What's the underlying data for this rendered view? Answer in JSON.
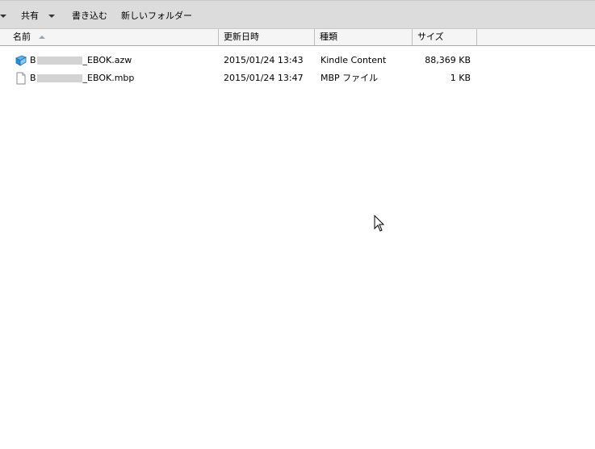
{
  "toolbar": {
    "share_label": "共有",
    "burn_label": "書き込む",
    "new_folder_label": "新しいフォルダー"
  },
  "columns": {
    "name": "名前",
    "date_modified": "更新日時",
    "type": "種類",
    "size": "サイズ"
  },
  "files": [
    {
      "name_prefix": "B",
      "name_suffix": "_EBOK.azw",
      "date": "2015/01/24 13:43",
      "type": "Kindle Content",
      "size": "88,369 KB",
      "icon": "kindle-book-icon"
    },
    {
      "name_prefix": "B",
      "name_suffix": "_EBOK.mbp",
      "date": "2015/01/24 13:47",
      "type": "MBP ファイル",
      "size": "1 KB",
      "icon": "blank-file-icon"
    }
  ],
  "colors": {
    "toolbar_bg": "#dcdcdc",
    "header_bg": "#f5f5f5",
    "kindle_icon": "#2e8fd6"
  }
}
